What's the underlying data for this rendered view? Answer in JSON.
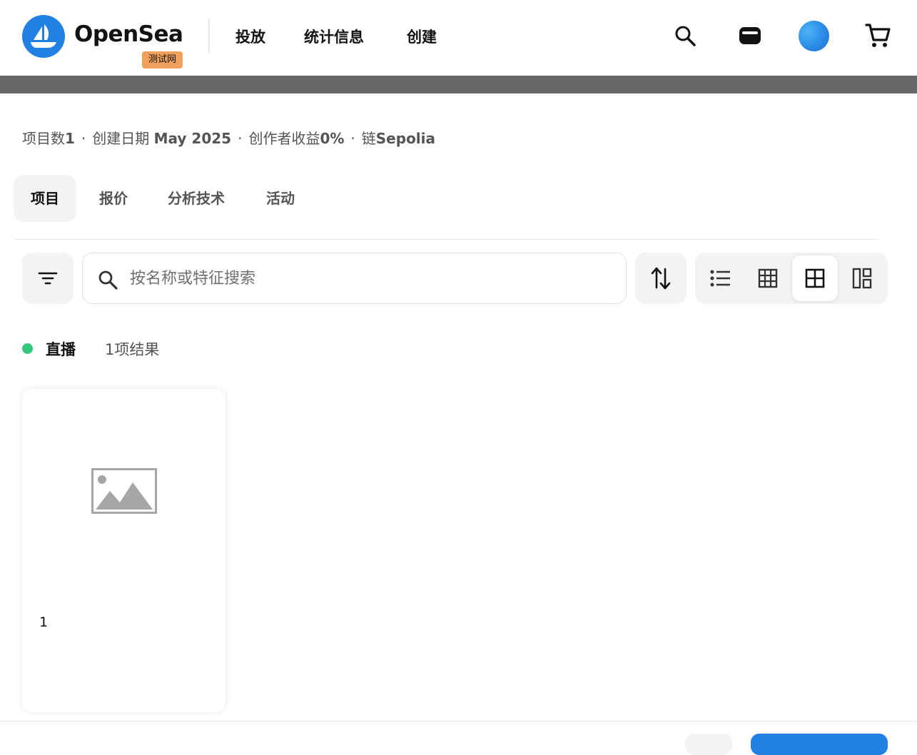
{
  "header": {
    "brand": "OpenSea",
    "testnet_badge": "测试网",
    "nav": [
      "投放",
      "统计信息",
      "创建"
    ],
    "icons": [
      "search-icon",
      "wallet-icon",
      "avatar",
      "cart-icon"
    ]
  },
  "meta": {
    "items_label": "项目数",
    "items_value": "1",
    "created_label": "创建日期",
    "created_value": "May 2025",
    "royalty_label": "创作者收益",
    "royalty_value": "0%",
    "chain_label": "链",
    "chain_value": "Sepolia",
    "separator": "·"
  },
  "tabs": [
    {
      "label": "项目",
      "active": true
    },
    {
      "label": "报价",
      "active": false
    },
    {
      "label": "分析技术",
      "active": false
    },
    {
      "label": "活动",
      "active": false
    }
  ],
  "toolbar": {
    "search_placeholder": "按名称或特征搜索",
    "view_modes": [
      "list-view-icon",
      "grid-small-icon",
      "grid-medium-icon",
      "grid-large-icon"
    ],
    "active_view": "grid-medium-icon"
  },
  "status": {
    "live_label": "直播",
    "results": "1项结果"
  },
  "items": [
    {
      "title": "1",
      "image": "image-placeholder-icon"
    }
  ],
  "colors": {
    "brand_blue": "#2081e2",
    "live_green": "#34c77b",
    "testnet_orange": "#f0a05a",
    "banner_gray": "#666666"
  }
}
